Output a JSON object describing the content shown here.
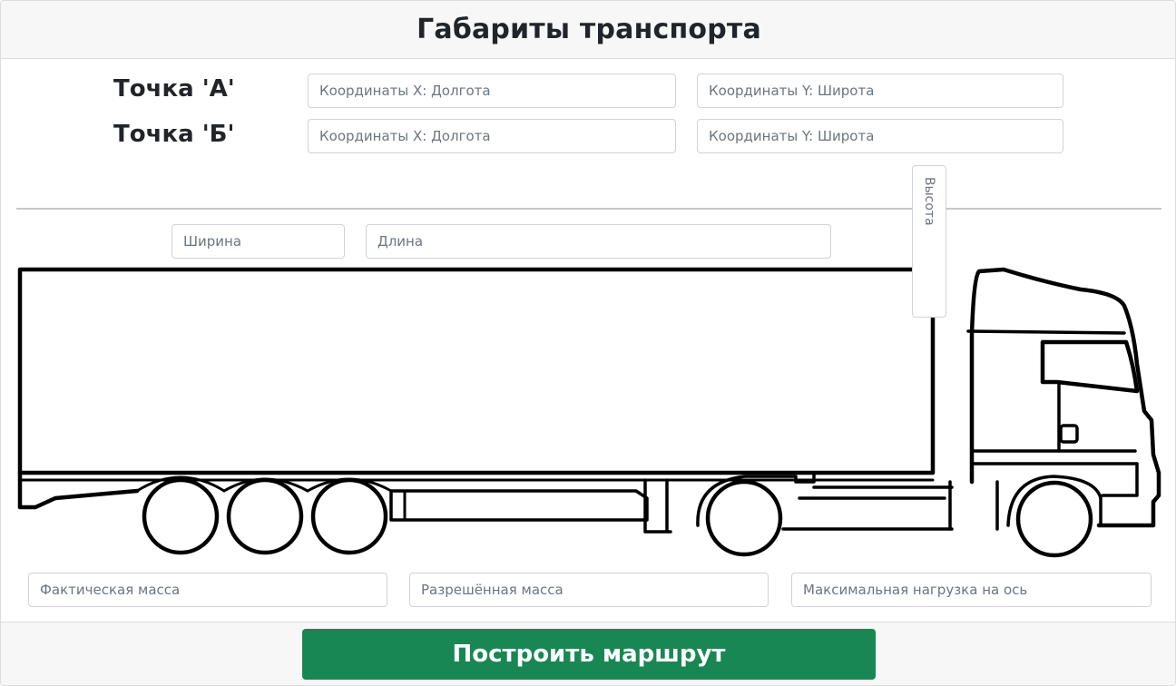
{
  "header": {
    "title": "Габариты транспорта"
  },
  "points": [
    {
      "label": "Точка 'А'",
      "x_placeholder": "Координаты X: Долгота",
      "y_placeholder": "Координаты Y: Широта",
      "x_value": "",
      "y_value": ""
    },
    {
      "label": "Точка 'Б'",
      "x_placeholder": "Координаты X: Долгота",
      "y_placeholder": "Координаты Y: Широта",
      "x_value": "",
      "y_value": ""
    }
  ],
  "dimensions": {
    "width_placeholder": "Ширина",
    "length_placeholder": "Длина",
    "height_placeholder": "Высота"
  },
  "mass": {
    "actual_placeholder": "Фактическая масса",
    "allowed_placeholder": "Разрешённая масса",
    "axle_placeholder": "Максимальная нагрузка на ось"
  },
  "actions": {
    "build_route_label": "Построить маршрут"
  },
  "colors": {
    "primary_button": "#198754",
    "header_bg": "#f7f7f7",
    "border": "#ced4da",
    "truck_outline": "#000000"
  },
  "icons": {
    "truck_diagram": "truck-outline-illustration"
  }
}
